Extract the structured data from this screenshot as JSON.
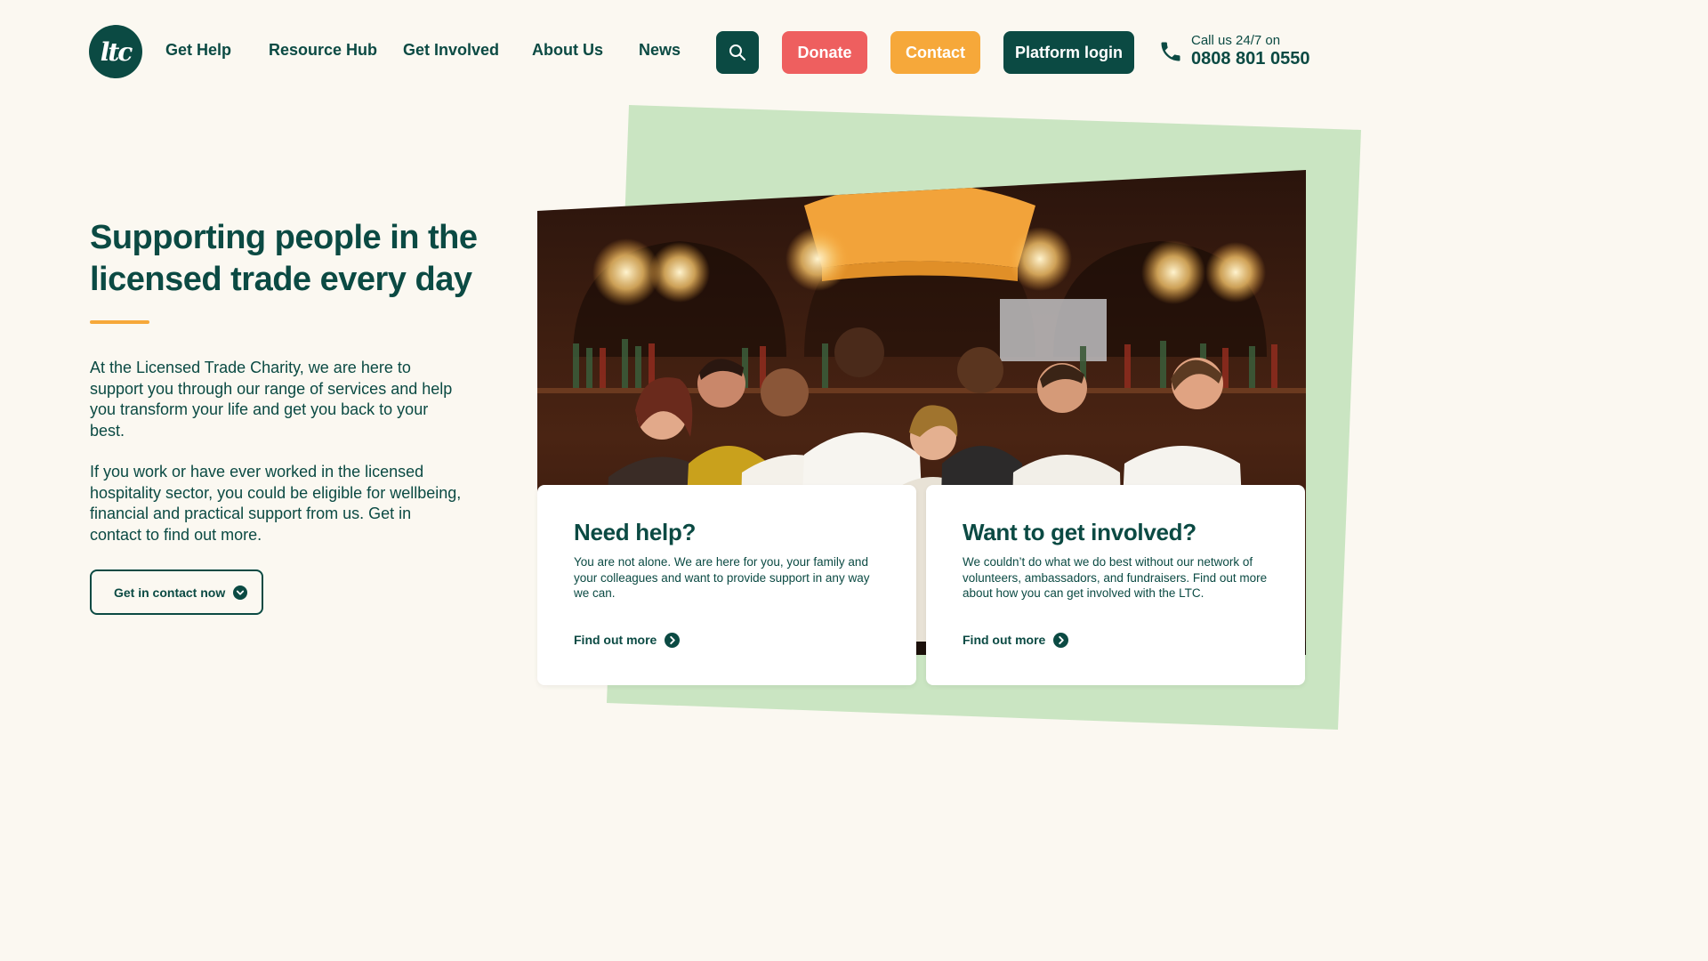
{
  "brand": {
    "logo_text": "ltc",
    "primary_color": "#0b4a43",
    "donate_color": "#ee5f5f",
    "contact_color": "#f6a83a",
    "accent_green": "#cae5c2",
    "background": "#fbf8f1"
  },
  "nav": {
    "items": [
      "Get Help",
      "Resource Hub",
      "Get Involved",
      "About Us",
      "News"
    ],
    "search_icon": "search-icon",
    "donate_label": "Donate",
    "contact_label": "Contact",
    "login_label": "Platform login",
    "phone_icon": "phone-icon",
    "call_label": "Call us 24/7 on",
    "call_number": "0808 801 0550"
  },
  "hero": {
    "title": "Supporting people in the licensed trade every day",
    "paragraph_1": "At the Licensed Trade Charity, we are here to support you through our range of services and help you transform your life and get you back to your best.",
    "paragraph_2": "If you work or have ever worked in the licensed hospitality sector, you could be eligible for wellbeing, financial and practical support from us. Get in contact to find out more.",
    "cta_label": "Get in contact now",
    "cta_icon": "chevron-down-icon"
  },
  "cards": [
    {
      "title": "Need help?",
      "text": "You are not alone. We are here for you, your family and your colleagues and want to provide support in any way we can.",
      "link_label": "Find out more",
      "link_icon": "chevron-right-icon"
    },
    {
      "title": "Want to get involved?",
      "text": "We couldn’t do what we do best without our network of volunteers, ambassadors, and fundraisers. Find out more about how you can get involved with the LTC.",
      "link_label": "Find out more",
      "link_icon": "chevron-right-icon"
    }
  ]
}
